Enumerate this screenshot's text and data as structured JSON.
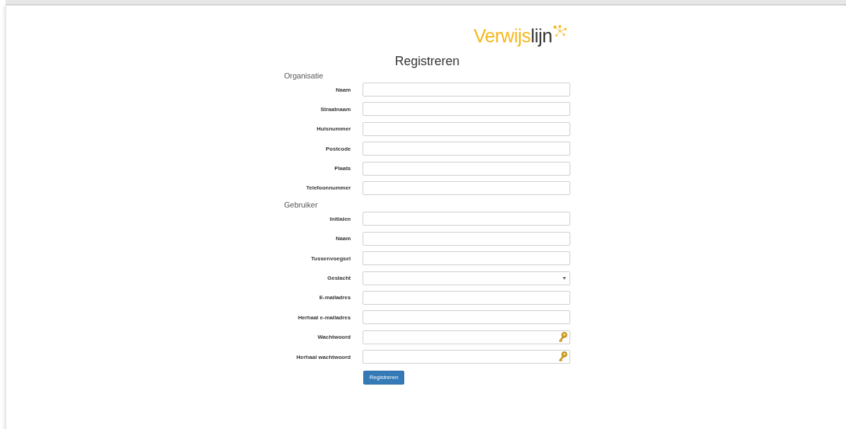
{
  "logo": {
    "text_accent": "Verwijs",
    "text_dark": "lijn"
  },
  "title": "Registreren",
  "sections": [
    {
      "heading": "Organisatie",
      "fields": [
        {
          "label": "Naam",
          "kind": "text"
        },
        {
          "label": "Straatnaam",
          "kind": "text"
        },
        {
          "label": "Huisnummer",
          "kind": "text"
        },
        {
          "label": "Postcode",
          "kind": "text"
        },
        {
          "label": "Plaats",
          "kind": "text"
        },
        {
          "label": "Telefoonnummer",
          "kind": "text"
        }
      ]
    },
    {
      "heading": "Gebruiker",
      "fields": [
        {
          "label": "Initialen",
          "kind": "text"
        },
        {
          "label": "Naam",
          "kind": "text"
        },
        {
          "label": "Tussenvoegsel",
          "kind": "text"
        },
        {
          "label": "Geslacht",
          "kind": "select"
        },
        {
          "label": "E-mailadres",
          "kind": "text"
        },
        {
          "label": "Herhaal e-mailadres",
          "kind": "text"
        },
        {
          "label": "Wachtwoord",
          "kind": "password"
        },
        {
          "label": "Herhaal wachtwoord",
          "kind": "password"
        }
      ]
    }
  ],
  "submit": "Registreren"
}
